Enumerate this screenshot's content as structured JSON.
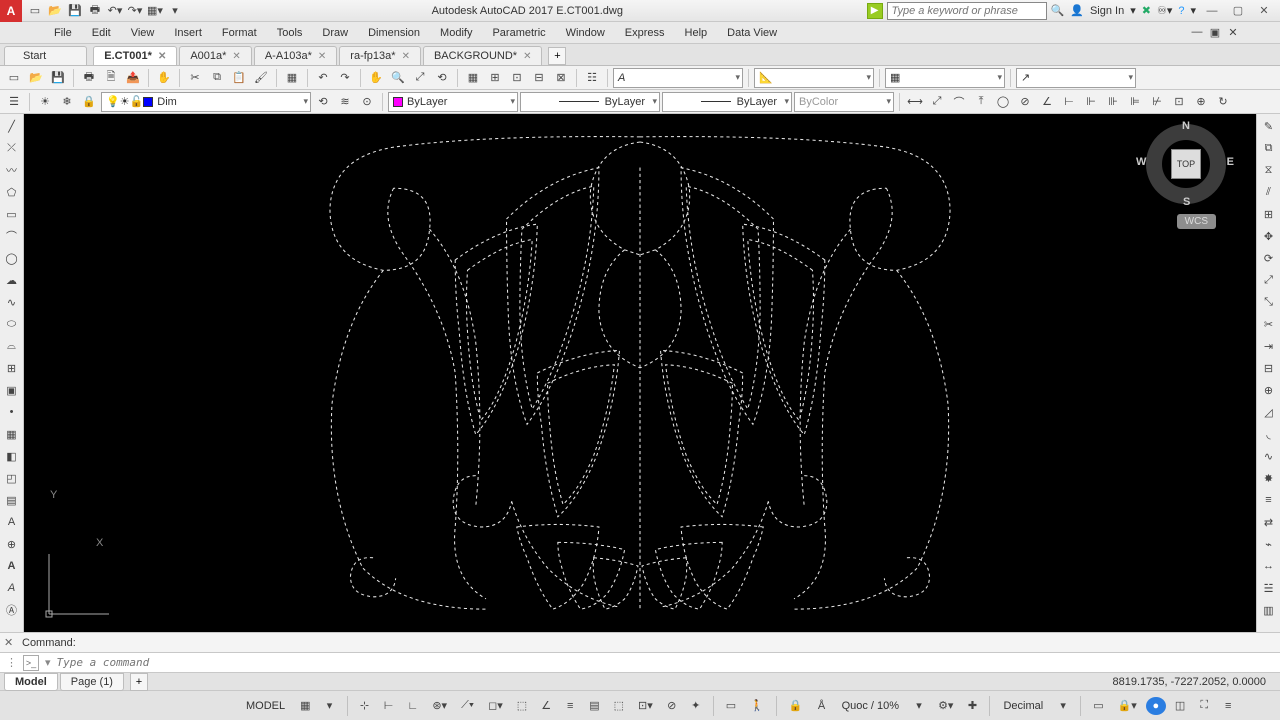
{
  "app": {
    "title": "Autodesk AutoCAD 2017   E.CT001.dwg",
    "logo_letter": "A"
  },
  "search": {
    "placeholder": "Type a keyword or phrase"
  },
  "signin": {
    "label": "Sign In"
  },
  "menu": [
    "File",
    "Edit",
    "View",
    "Insert",
    "Format",
    "Tools",
    "Draw",
    "Dimension",
    "Modify",
    "Parametric",
    "Window",
    "Express",
    "Help",
    "Data View"
  ],
  "start_tab": "Start",
  "tabs": [
    {
      "label": "E.CT001*",
      "active": true
    },
    {
      "label": "A001a*",
      "active": false
    },
    {
      "label": "A-A103a*",
      "active": false
    },
    {
      "label": "ra-fp13a*",
      "active": false
    },
    {
      "label": "BACKGROUND*",
      "active": false
    }
  ],
  "layer_combo": "Dim",
  "props": {
    "color": "ByLayer",
    "linetype": "ByLayer",
    "lineweight": "ByLayer",
    "plotstyle": "ByColor"
  },
  "viewcube": {
    "face": "TOP",
    "n": "N",
    "s": "S",
    "e": "E",
    "w": "W",
    "wcs": "WCS"
  },
  "ucs": {
    "x": "X",
    "y": "Y"
  },
  "cmd": {
    "history": "Command:",
    "placeholder": "Type a command"
  },
  "layout": {
    "tabs": [
      "Model",
      "Page (1)"
    ],
    "active": 0
  },
  "coords": "8819.1735, -7227.2052, 0.0000",
  "status": {
    "model": "MODEL",
    "scale": "Quoc / 10%",
    "units": "Decimal"
  }
}
